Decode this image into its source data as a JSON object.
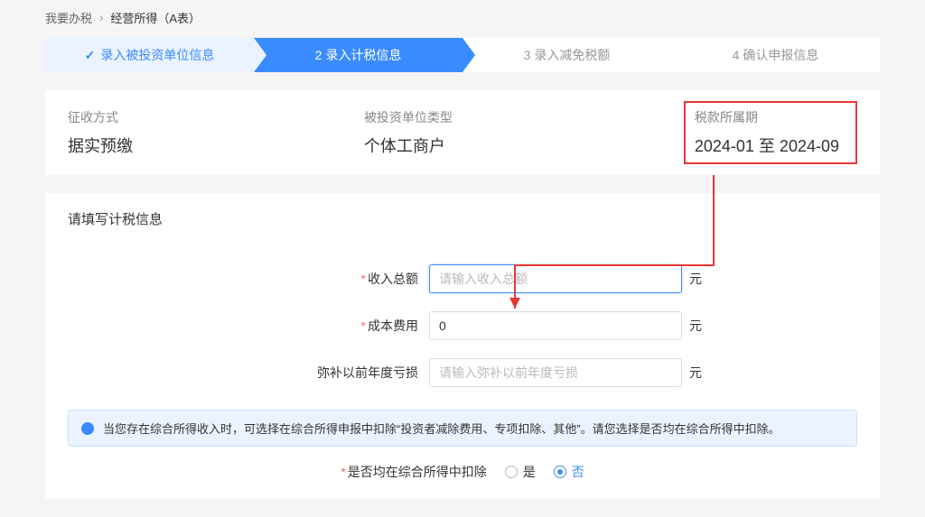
{
  "breadcrumb": {
    "item1": "我要办税",
    "current": "经营所得（A表）"
  },
  "steps": {
    "s1": "录入被投资单位信息",
    "s2": "2  录入计税信息",
    "s3": "3  录入减免税额",
    "s4": "4  确认申报信息"
  },
  "summary": {
    "method_label": "征收方式",
    "method_value": "据实预缴",
    "unit_type_label": "被投资单位类型",
    "unit_type_value": "个体工商户",
    "period_label": "税款所属期",
    "period_value": "2024-01 至 2024-09"
  },
  "section_title": "请填写计税信息",
  "form": {
    "income_label": "收入总额",
    "income_placeholder": "请输入收入总额",
    "cost_label": "成本费用",
    "cost_value": "0",
    "loss_label": "弥补以前年度亏损",
    "loss_placeholder": "请输入弥补以前年度亏损",
    "unit": "元"
  },
  "alert": {
    "text": "当您存在综合所得收入时，可选择在综合所得申报中扣除“投资者减除费用、专项扣除、其他”。请您选择是否均在综合所得中扣除。"
  },
  "radio": {
    "label": "是否均在综合所得中扣除",
    "yes": "是",
    "no": "否"
  }
}
